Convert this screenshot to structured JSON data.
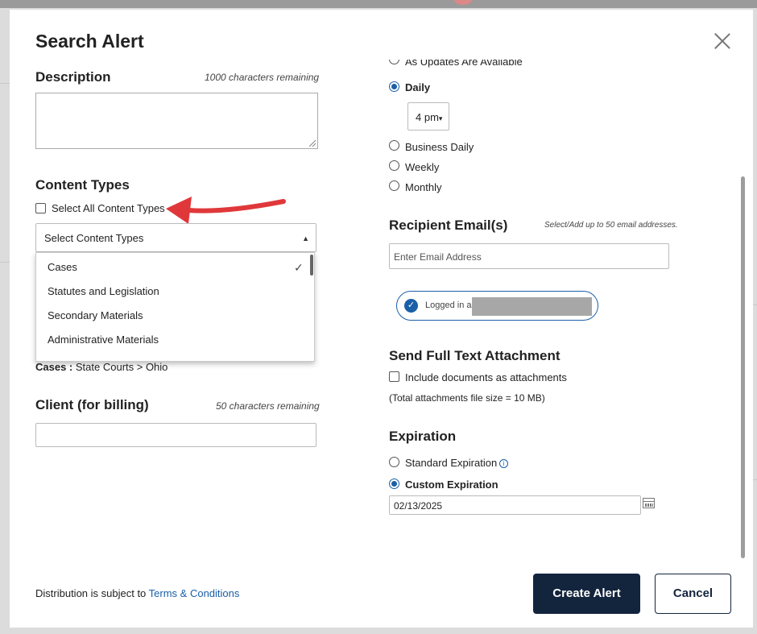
{
  "modal": {
    "title": "Search Alert",
    "close_label": "×"
  },
  "description": {
    "heading": "Description",
    "remaining": "1000 characters remaining",
    "value": ""
  },
  "content_types": {
    "heading": "Content Types",
    "select_all_label": "Select All Content Types",
    "select_placeholder": "Select Content Types",
    "options": [
      {
        "label": "Cases",
        "selected": true
      },
      {
        "label": "Statutes and Legislation",
        "selected": false
      },
      {
        "label": "Secondary Materials",
        "selected": false
      },
      {
        "label": "Administrative Materials",
        "selected": false
      }
    ],
    "check_glyph": "✓",
    "selection_key": "Cases :",
    "selection_value": "State Courts > Ohio"
  },
  "client": {
    "heading": "Client (for billing)",
    "remaining": "50 characters remaining",
    "value": ""
  },
  "frequency": {
    "options": [
      {
        "label": "As Updates Are Available",
        "selected": false
      },
      {
        "label": "Daily",
        "selected": true
      },
      {
        "label": "Business Daily",
        "selected": false
      },
      {
        "label": "Weekly",
        "selected": false
      },
      {
        "label": "Monthly",
        "selected": false
      }
    ],
    "time_value": "4 pm",
    "time_caret": "▾"
  },
  "recipients": {
    "heading": "Recipient Email(s)",
    "hint": "Select/Add up to 50 email addresses.",
    "placeholder": "Enter Email Address",
    "logged_in_label": "Logged in as"
  },
  "attachment": {
    "heading": "Send Full Text Attachment",
    "include_label": "Include documents as attachments",
    "note": "(Total attachments file size = 10 MB)"
  },
  "expiration": {
    "heading": "Expiration",
    "standard_label": "Standard Expiration",
    "custom_label": "Custom Expiration",
    "selected": "custom",
    "date_value": "02/13/2025"
  },
  "footer": {
    "text": "Distribution is subject to",
    "link": "Terms & Conditions",
    "create_button": "Create Alert",
    "cancel_button": "Cancel"
  },
  "colors": {
    "primary": "#13243d",
    "accent": "#1a5fa8",
    "annotation_arrow": "#e0383a"
  },
  "icons": {
    "close": "close-icon",
    "calendar": "calendar-icon",
    "info": "info-icon",
    "check": "check-icon"
  }
}
